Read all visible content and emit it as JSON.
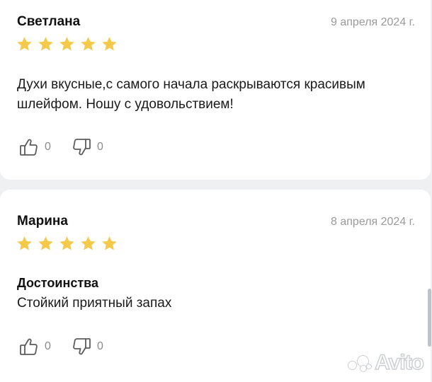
{
  "reviews": [
    {
      "author": "Светлана",
      "date": "9 апреля 2024 г.",
      "rating": 5,
      "text": "Духи вкусные,с самого начала раскрываются красивым шлейфом. Ношу с удовольствием!",
      "likes": "0",
      "dislikes": "0"
    },
    {
      "author": "Марина",
      "date": "8 апреля 2024 г.",
      "rating": 5,
      "advantages_label": "Достоинства",
      "text": "Стойкий приятный запах",
      "likes": "0",
      "dislikes": "0"
    }
  ],
  "watermark": "Avito",
  "colors": {
    "star": "#f5c94a",
    "muted": "#9a9a9a",
    "background": "#eef0f2"
  }
}
